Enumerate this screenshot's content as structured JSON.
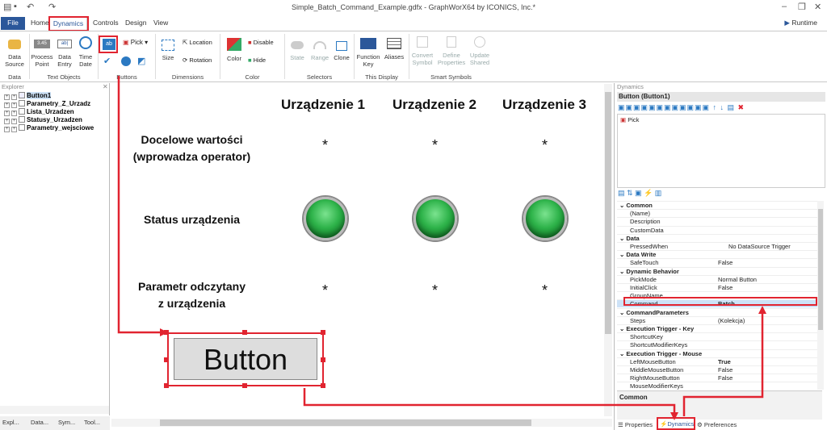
{
  "window": {
    "title": "Simple_Batch_Command_Example.gdfx - GraphWorX64 by ICONICS, Inc.*",
    "tabs": [
      "File",
      "Home",
      "Dynamics",
      "Controls",
      "Design",
      "View"
    ],
    "runtime_label": "Runtime"
  },
  "ribbon": {
    "data_source": "Data Source",
    "process_point": "Process Point",
    "data_entry": "Data Entry",
    "time_date": "Time Date",
    "pick": "Pick",
    "size": "Size",
    "location": "Location",
    "rotation": "Rotation",
    "color": "Color",
    "disable": "Disable",
    "hide": "Hide",
    "state": "State",
    "range": "Range",
    "clone": "Clone",
    "function_key": "Function Key",
    "aliases": "Aliases",
    "convert_symbol": "Convert Symbol",
    "define_properties": "Define Properties",
    "update_shared": "Update Shared",
    "groups": [
      "Data",
      "Text Objects",
      "Buttons",
      "Dimensions",
      "Color",
      "Selectors",
      "This Display",
      "Smart Symbols"
    ],
    "pp_badge": "3.45",
    "ab": "ab|"
  },
  "explorer": {
    "header": "Explorer",
    "items": [
      "Button1",
      "Parametry_Z_Urzadz",
      "Lista_Urzadzen",
      "Statusy_Urzadzen",
      "Parametry_wejsciowe"
    ],
    "tabs": [
      "Expl...",
      "Data...",
      "Sym...",
      "Tool..."
    ]
  },
  "canvas": {
    "columns": [
      "Urządzenie 1",
      "Urządzenie 2",
      "Urządzenie 3"
    ],
    "row1": "Docelowe wartości\n(wprowadza operator)",
    "row1a": "Docelowe wartości",
    "row1b": "(wprowadza operator)",
    "row2": "Status urządzenia",
    "row3a": "Parametr odczytany",
    "row3b": "z urządzenia",
    "star": "*",
    "button_label": "Button"
  },
  "dynamics": {
    "header": "Dynamics",
    "title": "Button (Button1)",
    "pick_item": "Pick",
    "properties": [
      {
        "cat": true,
        "name": "Common"
      },
      {
        "name": "(Name)",
        "value": ""
      },
      {
        "name": "Description",
        "value": ""
      },
      {
        "name": "CustomData",
        "value": ""
      },
      {
        "cat": true,
        "name": "Data"
      },
      {
        "name": "PressedWhen",
        "value": "No DataSource Trigger"
      },
      {
        "cat": true,
        "name": "Data Write"
      },
      {
        "name": "SafeTouch",
        "value": "False"
      },
      {
        "cat": true,
        "name": "Dynamic Behavior"
      },
      {
        "name": "PickMode",
        "value": "Normal Button"
      },
      {
        "name": "InitialClick",
        "value": "False"
      },
      {
        "name": "GroupName",
        "value": ""
      },
      {
        "name": "Command",
        "value": "Batch"
      },
      {
        "cat": true,
        "name": "CommandParameters"
      },
      {
        "name": "Steps",
        "value": "(Kolekcja)"
      },
      {
        "cat": true,
        "name": "Execution Trigger - Key"
      },
      {
        "name": "ShortcutKey",
        "value": ""
      },
      {
        "name": "ShortcutModifierKeys",
        "value": ""
      },
      {
        "cat": true,
        "name": "Execution Trigger - Mouse"
      },
      {
        "name": "LeftMouseButton",
        "value": "True"
      },
      {
        "name": "MiddleMouseButton",
        "value": "False"
      },
      {
        "name": "RightMouseButton",
        "value": "False"
      },
      {
        "name": "MouseModifierKeys",
        "value": ""
      }
    ],
    "footer_section": "Common",
    "bottom_tabs": [
      "Properties",
      "Dynamics",
      "Preferences"
    ]
  },
  "colors": {
    "accent": "#2b579a",
    "highlight": "#e12430",
    "led": "#2eb34a"
  }
}
